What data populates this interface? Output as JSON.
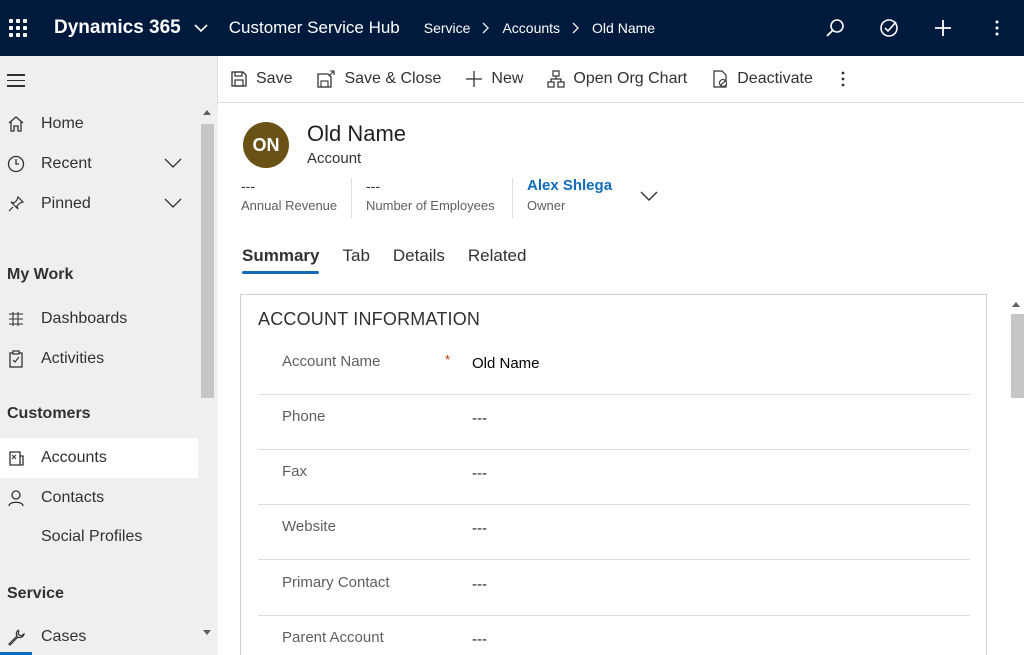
{
  "topbar": {
    "brand": "Dynamics 365",
    "app_name": "Customer Service Hub",
    "breadcrumb": [
      "Service",
      "Accounts",
      "Old Name"
    ]
  },
  "sidebar": {
    "items_top": [
      {
        "label": "Home",
        "icon": "home-icon"
      },
      {
        "label": "Recent",
        "icon": "clock-icon",
        "expandable": true
      },
      {
        "label": "Pinned",
        "icon": "pin-icon",
        "expandable": true
      }
    ],
    "sections": {
      "my_work": "My Work",
      "customers": "Customers",
      "service": "Service"
    },
    "my_work_items": [
      {
        "label": "Dashboards",
        "icon": "dashboard-icon"
      },
      {
        "label": "Activities",
        "icon": "activities-icon"
      }
    ],
    "customers_items": [
      {
        "label": "Accounts",
        "icon": "accounts-icon",
        "active": true
      },
      {
        "label": "Contacts",
        "icon": "person-icon"
      },
      {
        "label": "Social Profiles",
        "icon": ""
      }
    ],
    "service_items": [
      {
        "label": "Cases",
        "icon": "wrench-icon"
      }
    ]
  },
  "commands": {
    "save": "Save",
    "save_close": "Save & Close",
    "new": "New",
    "org_chart": "Open Org Chart",
    "deactivate": "Deactivate"
  },
  "record": {
    "initials": "ON",
    "title": "Old Name",
    "entity": "Account",
    "avatar_color": "#6a5217",
    "header_fields": [
      {
        "value": "---",
        "label": "Annual Revenue"
      },
      {
        "value": "---",
        "label": "Number of Employees"
      },
      {
        "value": "Alex Shlega",
        "label": "Owner"
      }
    ]
  },
  "tabs": [
    "Summary",
    "Tab",
    "Details",
    "Related"
  ],
  "section": {
    "title": "ACCOUNT INFORMATION",
    "fields": [
      {
        "label": "Account Name",
        "required_mark": "*",
        "value": "Old Name"
      },
      {
        "label": "Phone",
        "value": "---"
      },
      {
        "label": "Fax",
        "value": "---"
      },
      {
        "label": "Website",
        "value": "---"
      },
      {
        "label": "Primary Contact",
        "value": "---"
      },
      {
        "label": "Parent Account",
        "value": "---"
      }
    ]
  },
  "colors": {
    "topbar_bg": "#001a3d",
    "accent": "#0f6cbd",
    "required": "#c43501"
  }
}
